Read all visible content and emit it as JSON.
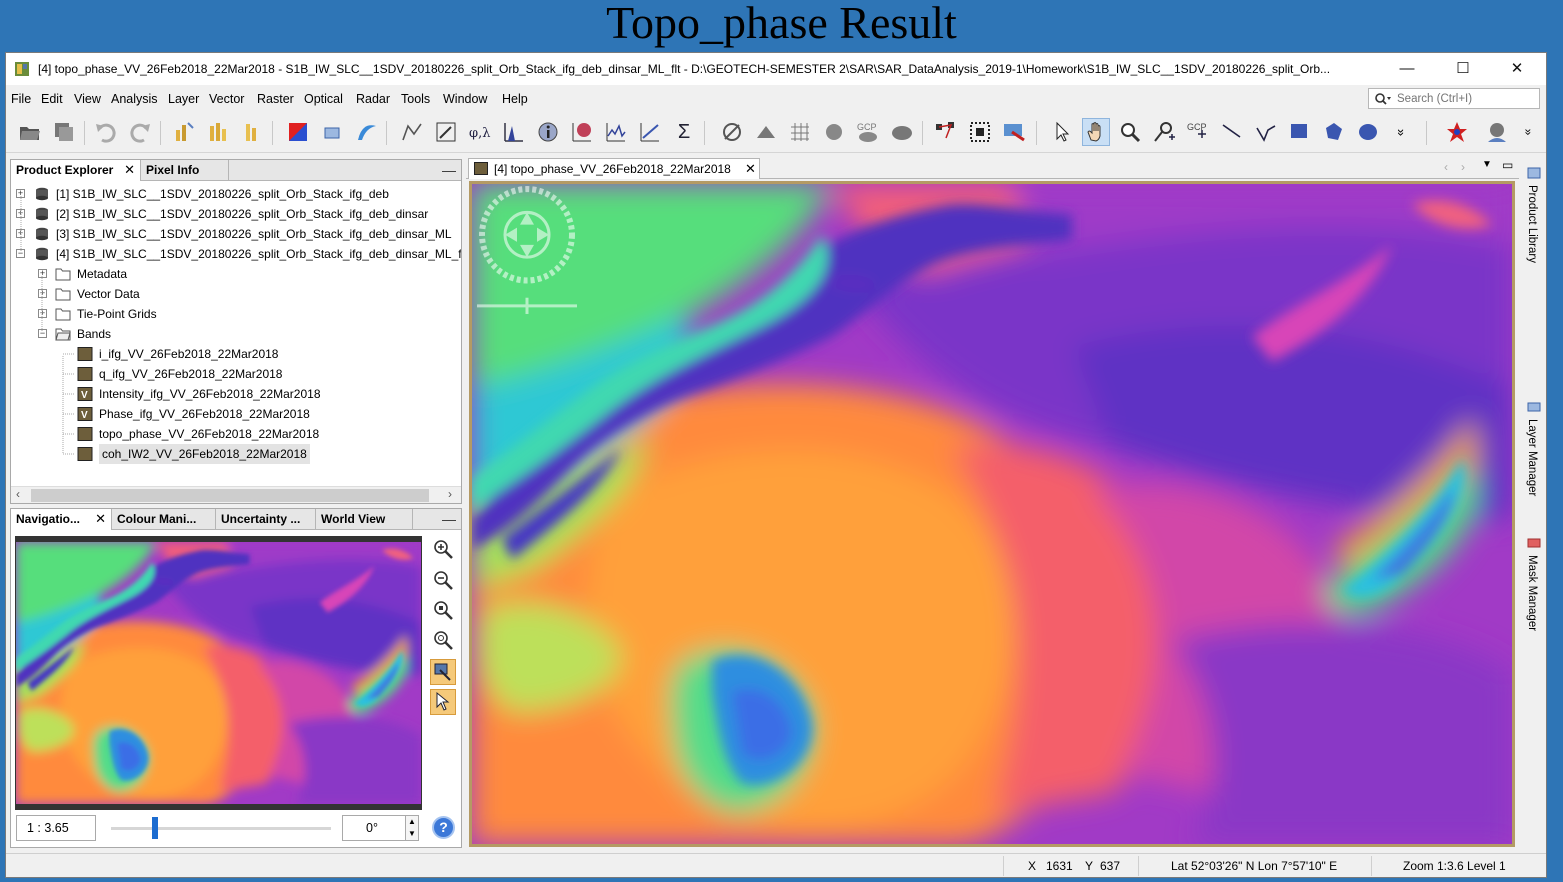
{
  "slide": {
    "title": "Topo_phase Result"
  },
  "window": {
    "title": "[4] topo_phase_VV_26Feb2018_22Mar2018 - S1B_IW_SLC__1SDV_20180226_split_Orb_Stack_ifg_deb_dinsar_ML_flt - D:\\GEOTECH-SEMESTER 2\\SAR\\SAR_DataAnalysis_2019-1\\Homework\\S1B_IW_SLC__1SDV_20180226_split_Orb...",
    "minimize": "—",
    "maximize": "☐",
    "close": "✕"
  },
  "menu": [
    "File",
    "Edit",
    "View",
    "Analysis",
    "Layer",
    "Vector",
    "Raster",
    "Optical",
    "Radar",
    "Tools",
    "Window",
    "Help"
  ],
  "search": {
    "placeholder": "Search (Ctrl+I)"
  },
  "toolbar": {
    "gcp_label": "GCP",
    "sigma": "Σ",
    "phi_label": "φ,λ",
    "more": "»"
  },
  "product_explorer": {
    "tabs": [
      "Product Explorer",
      "Pixel Info"
    ],
    "close": "✕",
    "minimize": "—",
    "products": [
      "[1] S1B_IW_SLC__1SDV_20180226_split_Orb_Stack_ifg_deb",
      "[2] S1B_IW_SLC__1SDV_20180226_split_Orb_Stack_ifg_deb_dinsar",
      "[3] S1B_IW_SLC__1SDV_20180226_split_Orb_Stack_ifg_deb_dinsar_ML",
      "[4] S1B_IW_SLC__1SDV_20180226_split_Orb_Stack_ifg_deb_dinsar_ML_f"
    ],
    "folders": [
      "Metadata",
      "Vector Data",
      "Tie-Point Grids",
      "Bands"
    ],
    "bands": [
      {
        "label": "i_ifg_VV_26Feb2018_22Mar2018",
        "badge": ""
      },
      {
        "label": "q_ifg_VV_26Feb2018_22Mar2018",
        "badge": ""
      },
      {
        "label": "Intensity_ifg_VV_26Feb2018_22Mar2018",
        "badge": "V"
      },
      {
        "label": "Phase_ifg_VV_26Feb2018_22Mar2018",
        "badge": "V"
      },
      {
        "label": "topo_phase_VV_26Feb2018_22Mar2018",
        "badge": ""
      },
      {
        "label": "coh_IW2_VV_26Feb2018_22Mar2018",
        "badge": ""
      }
    ],
    "selected_band": "coh_IW2_VV_26Feb2018_22Mar2018"
  },
  "navigation": {
    "tabs": [
      "Navigatio...",
      "Colour Mani...",
      "Uncertainty ...",
      "World View"
    ],
    "scale_value": "1 : 3.65",
    "rotation_value": "0°",
    "slider_position": 0.2,
    "help": "?"
  },
  "image_view": {
    "tab_label": "[4] topo_phase_VV_26Feb2018_22Mar2018",
    "close": "✕"
  },
  "side_panels": [
    "Product Library",
    "Layer Manager",
    "Mask Manager"
  ],
  "status": {
    "x_label": "X",
    "x_value": "1631",
    "y_label": "Y",
    "y_value": "637",
    "latlon": "Lat 52°03'26\" N  Lon 7°57'10\" E",
    "zoom": "Zoom 1:3.6  Level 1"
  },
  "colors": {
    "slide_bg": "#2e75b6",
    "image_frame": "#b49a64",
    "colormap": [
      "#5a2fc0",
      "#b43cc8",
      "#e8489c",
      "#ff6a4e",
      "#ffa23c",
      "#c8e650",
      "#4ce67c",
      "#2ecfd8",
      "#3a7fe0"
    ]
  }
}
